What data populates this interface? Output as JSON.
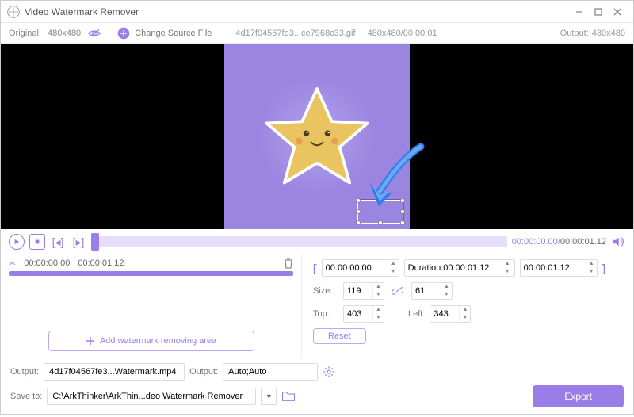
{
  "window": {
    "title": "Video Watermark Remover"
  },
  "toolbar": {
    "original_label": "Original:",
    "original_dim": "480x480",
    "change_source": "Change Source File",
    "filename": "4d17f04567fe3...ce7968c33.gif",
    "file_dim_time": "480x480/00:00:01",
    "output_label": "Output:",
    "output_dim": "480x480"
  },
  "playback": {
    "current": "00:00:00.00",
    "total": "00:00:01.12"
  },
  "clip": {
    "start": "00:00:00.00",
    "end": "00:00:01.12"
  },
  "addarea": {
    "label": "Add watermark removing area"
  },
  "range": {
    "start": "00:00:00.00",
    "dur_label": "Duration:",
    "dur_val": "00:00:01.12",
    "end": "00:00:01.12"
  },
  "size": {
    "label": "Size:",
    "w": "119",
    "h": "61"
  },
  "pos": {
    "top_label": "Top:",
    "top": "403",
    "left_label": "Left:",
    "left": "343"
  },
  "reset": {
    "label": "Reset"
  },
  "bottom": {
    "output_label": "Output:",
    "output_file": "4d17f04567fe3...Watermark.mp4",
    "fmt_label": "Output:",
    "fmt_val": "Auto;Auto",
    "save_label": "Save to:",
    "save_val": "C:\\ArkThinker\\ArkThin...deo Watermark Remover",
    "export": "Export"
  },
  "icons": {
    "cut": "✂"
  }
}
